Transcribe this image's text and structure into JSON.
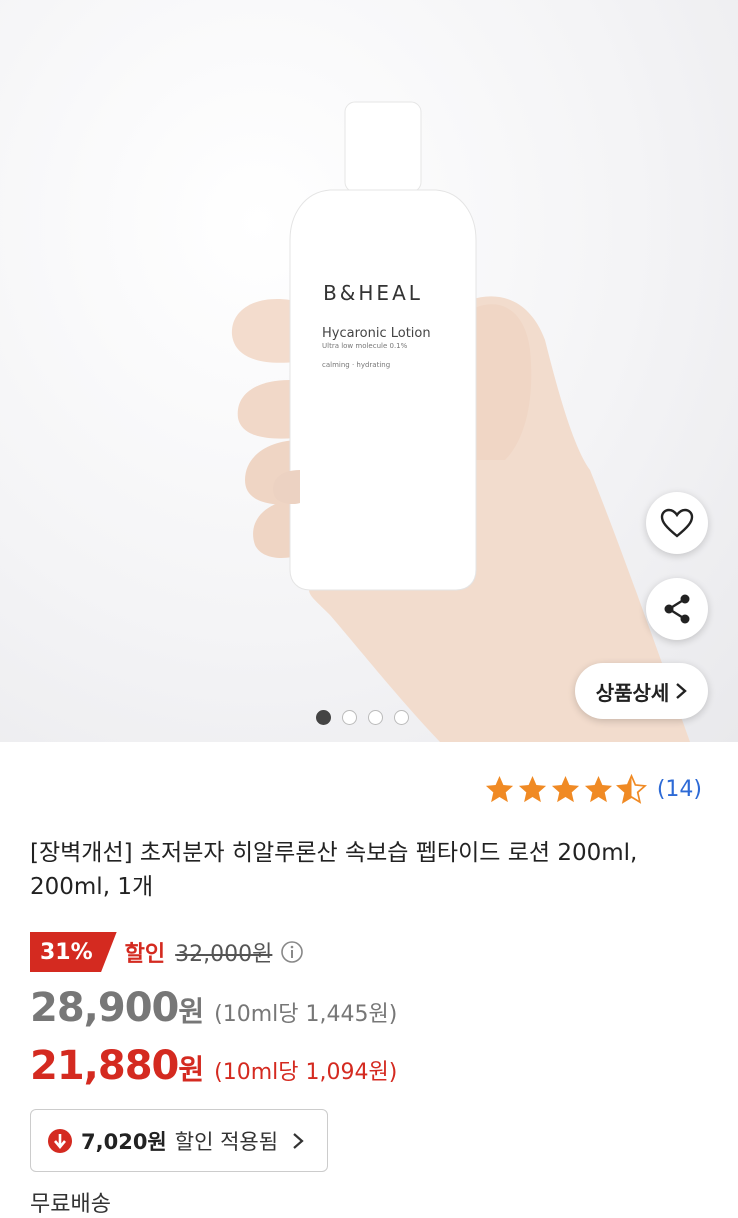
{
  "hero": {
    "brand": "B&HEAL",
    "product_line": "Hycaronic Lotion",
    "product_sub": "Ultra low molecule 0.1%",
    "product_tag": "calming · hydrating",
    "detail_label": "상품상세",
    "carousel_total": 4,
    "carousel_active": 1
  },
  "rating": {
    "stars": 4.5,
    "count": "(14)"
  },
  "product": {
    "title": "[장벽개선] 초저분자 히알루론산 속보습 펩타이드 로션 200ml, 200ml, 1개"
  },
  "discount": {
    "percent": "31%",
    "label": "할인",
    "original_price": "32,000원"
  },
  "price_list": {
    "value": "28,900",
    "won": "원",
    "unit_price": "(10ml당 1,445원)"
  },
  "price_sale": {
    "value": "21,880",
    "won": "원",
    "unit_price": "(10ml당 1,094원)"
  },
  "coupon": {
    "amount": "7,020원",
    "text": "할인 적용됨"
  },
  "shipping": {
    "label": "무료배송"
  },
  "colors": {
    "accent_red": "#d42a20",
    "star": "#f08a24",
    "link_blue": "#2d6ad6"
  }
}
